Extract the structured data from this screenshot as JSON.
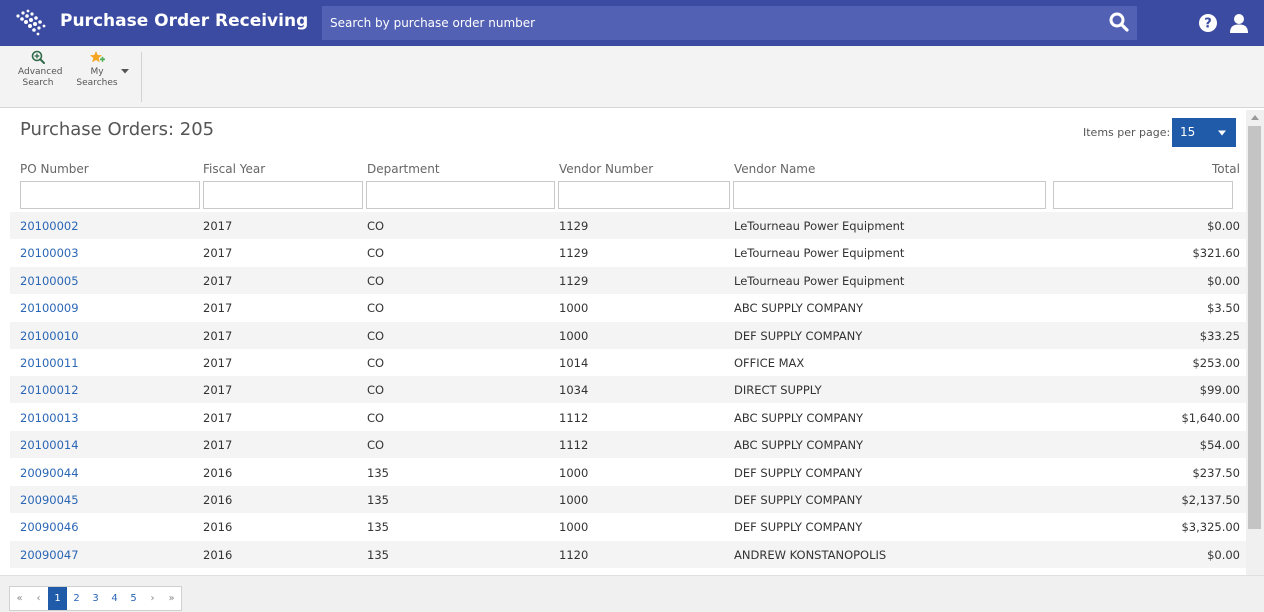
{
  "header": {
    "title": "Purchase Order Receiving",
    "search_placeholder": "Search by purchase order number",
    "icons": [
      "logo-icon",
      "search-icon",
      "help-icon",
      "user-icon"
    ],
    "colors": {
      "header_bg": "#3b4ba1",
      "search_bg": "#5361b5"
    }
  },
  "toolbar": {
    "advanced_search": {
      "line1": "Advanced",
      "line2": "Search"
    },
    "my_searches": {
      "line1": "My",
      "line2": "Searches"
    }
  },
  "main": {
    "title": "Purchase Orders: 205",
    "items_per_page_label": "Items per page:",
    "items_per_page_value": "15",
    "columns": [
      "PO Number",
      "Fiscal Year",
      "Department",
      "Vendor Number",
      "Vendor Name",
      "Total"
    ],
    "rows": [
      [
        "20100002",
        "2017",
        "CO",
        "1129",
        "LeTourneau Power Equipment",
        "$0.00"
      ],
      [
        "20100003",
        "2017",
        "CO",
        "1129",
        "LeTourneau Power Equipment",
        "$321.60"
      ],
      [
        "20100005",
        "2017",
        "CO",
        "1129",
        "LeTourneau Power Equipment",
        "$0.00"
      ],
      [
        "20100009",
        "2017",
        "CO",
        "1000",
        "ABC SUPPLY COMPANY",
        "$3.50"
      ],
      [
        "20100010",
        "2017",
        "CO",
        "1000",
        "DEF SUPPLY COMPANY",
        "$33.25"
      ],
      [
        "20100011",
        "2017",
        "CO",
        "1014",
        "OFFICE MAX",
        "$253.00"
      ],
      [
        "20100012",
        "2017",
        "CO",
        "1034",
        "DIRECT SUPPLY",
        "$99.00"
      ],
      [
        "20100013",
        "2017",
        "CO",
        "1112",
        "ABC SUPPLY COMPANY",
        "$1,640.00"
      ],
      [
        "20100014",
        "2017",
        "CO",
        "1112",
        "ABC SUPPLY COMPANY",
        "$54.00"
      ],
      [
        "20090044",
        "2016",
        "135",
        "1000",
        "DEF SUPPLY COMPANY",
        "$237.50"
      ],
      [
        "20090045",
        "2016",
        "135",
        "1000",
        "DEF SUPPLY COMPANY",
        "$2,137.50"
      ],
      [
        "20090046",
        "2016",
        "135",
        "1000",
        "DEF SUPPLY COMPANY",
        "$3,325.00"
      ],
      [
        "20090047",
        "2016",
        "135",
        "1120",
        "ANDREW KONSTANOPOLIS",
        "$0.00"
      ]
    ]
  },
  "pager": {
    "first": "«",
    "prev": "‹",
    "pages": [
      "1",
      "2",
      "3",
      "4",
      "5"
    ],
    "active_page": "1",
    "next": "›",
    "last": "»",
    "accent": "#1f5ba8"
  }
}
